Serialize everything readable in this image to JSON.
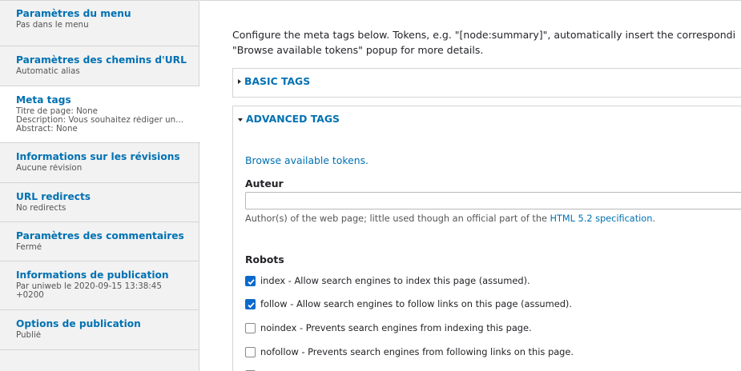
{
  "sidebar": {
    "items": [
      {
        "label": "Paramètres du menu",
        "summary": [
          "Pas dans le menu"
        ]
      },
      {
        "label": "Paramètres des chemins d'URL",
        "summary": [
          "Automatic alias"
        ]
      },
      {
        "label": "Meta tags",
        "summary": [
          "Titre de page: None",
          "Description: Vous souhaitez rédiger un...",
          "Abstract: None"
        ]
      },
      {
        "label": "Informations sur les révisions",
        "summary": [
          "Aucune révision"
        ]
      },
      {
        "label": "URL redirects",
        "summary": [
          "No redirects"
        ]
      },
      {
        "label": "Paramètres des commentaires",
        "summary": [
          "Fermé"
        ]
      },
      {
        "label": "Informations de publication",
        "summary": [
          "Par uniweb le 2020-09-15 13:38:45",
          "+0200"
        ]
      },
      {
        "label": "Options de publication",
        "summary": [
          "Publié"
        ]
      }
    ]
  },
  "main": {
    "intro_line1": "Configure the meta tags below. Tokens, e.g. \"[node:summary]\", automatically insert the correspondi",
    "intro_line2": "\"Browse available tokens\" popup for more details.",
    "basic_tags": "BASIC TAGS",
    "advanced_tags": "ADVANCED TAGS",
    "browse_tokens": "Browse available tokens.",
    "auteur": {
      "label": "Auteur",
      "value": "",
      "desc_before": "Author(s) of the web page; little used though an official part of the ",
      "desc_link": "HTML 5.2 specification",
      "desc_after": "."
    },
    "robots": {
      "label": "Robots",
      "options": [
        {
          "label": "index - Allow search engines to index this page (assumed).",
          "checked": true
        },
        {
          "label": "follow - Allow search engines to follow links on this page (assumed).",
          "checked": true
        },
        {
          "label": "noindex - Prevents search engines from indexing this page.",
          "checked": false
        },
        {
          "label": "nofollow - Prevents search engines from following links on this page.",
          "checked": false
        }
      ]
    }
  },
  "colors": {
    "link": "#0071b3",
    "checkbox_checked": "#0a6acb"
  }
}
